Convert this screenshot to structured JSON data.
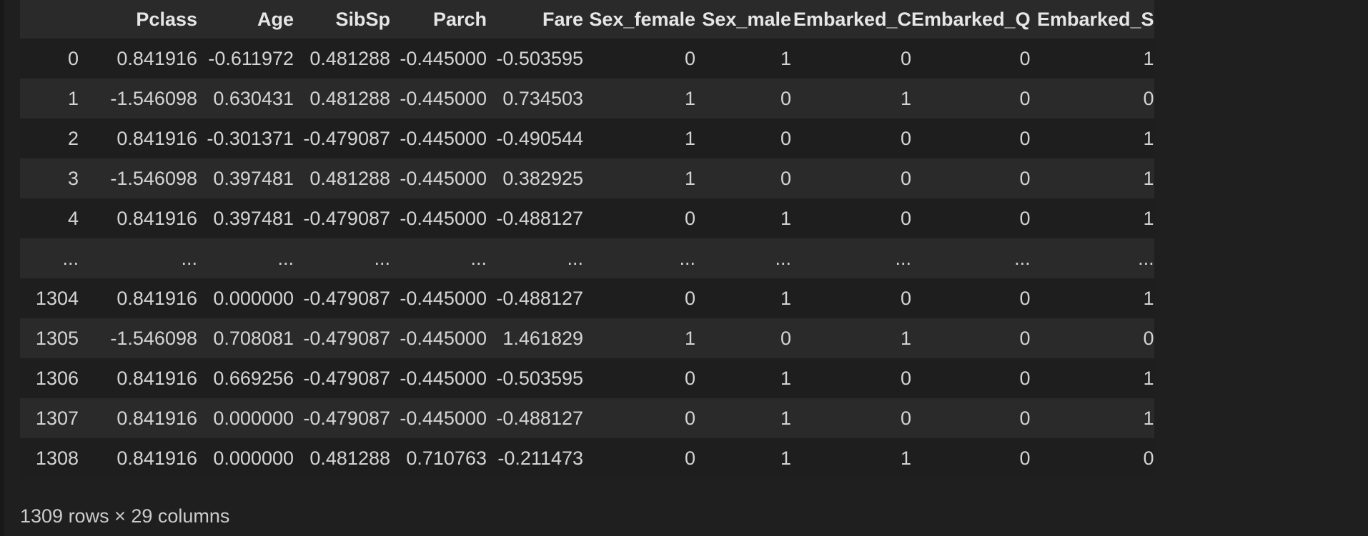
{
  "table": {
    "columns": [
      "",
      "Pclass",
      "Age",
      "SibSp",
      "Parch",
      "Fare",
      "Sex_female",
      "Sex_male",
      "Embarked_C",
      "Embarked_Q",
      "Embarked_S"
    ],
    "rows": [
      [
        "0",
        "0.841916",
        "-0.611972",
        "0.481288",
        "-0.445000",
        "-0.503595",
        "0",
        "1",
        "0",
        "0",
        "1"
      ],
      [
        "1",
        "-1.546098",
        "0.630431",
        "0.481288",
        "-0.445000",
        "0.734503",
        "1",
        "0",
        "1",
        "0",
        "0"
      ],
      [
        "2",
        "0.841916",
        "-0.301371",
        "-0.479087",
        "-0.445000",
        "-0.490544",
        "1",
        "0",
        "0",
        "0",
        "1"
      ],
      [
        "3",
        "-1.546098",
        "0.397481",
        "0.481288",
        "-0.445000",
        "0.382925",
        "1",
        "0",
        "0",
        "0",
        "1"
      ],
      [
        "4",
        "0.841916",
        "0.397481",
        "-0.479087",
        "-0.445000",
        "-0.488127",
        "0",
        "1",
        "0",
        "0",
        "1"
      ],
      [
        "...",
        "...",
        "...",
        "...",
        "...",
        "...",
        "...",
        "...",
        "...",
        "...",
        "..."
      ],
      [
        "1304",
        "0.841916",
        "0.000000",
        "-0.479087",
        "-0.445000",
        "-0.488127",
        "0",
        "1",
        "0",
        "0",
        "1"
      ],
      [
        "1305",
        "-1.546098",
        "0.708081",
        "-0.479087",
        "-0.445000",
        "1.461829",
        "1",
        "0",
        "1",
        "0",
        "0"
      ],
      [
        "1306",
        "0.841916",
        "0.669256",
        "-0.479087",
        "-0.445000",
        "-0.503595",
        "0",
        "1",
        "0",
        "0",
        "1"
      ],
      [
        "1307",
        "0.841916",
        "0.000000",
        "-0.479087",
        "-0.445000",
        "-0.488127",
        "0",
        "1",
        "0",
        "0",
        "1"
      ],
      [
        "1308",
        "0.841916",
        "0.000000",
        "0.481288",
        "0.710763",
        "-0.211473",
        "0",
        "1",
        "1",
        "0",
        "0"
      ]
    ]
  },
  "footer": {
    "shape_text": "1309 rows × 29 columns"
  }
}
